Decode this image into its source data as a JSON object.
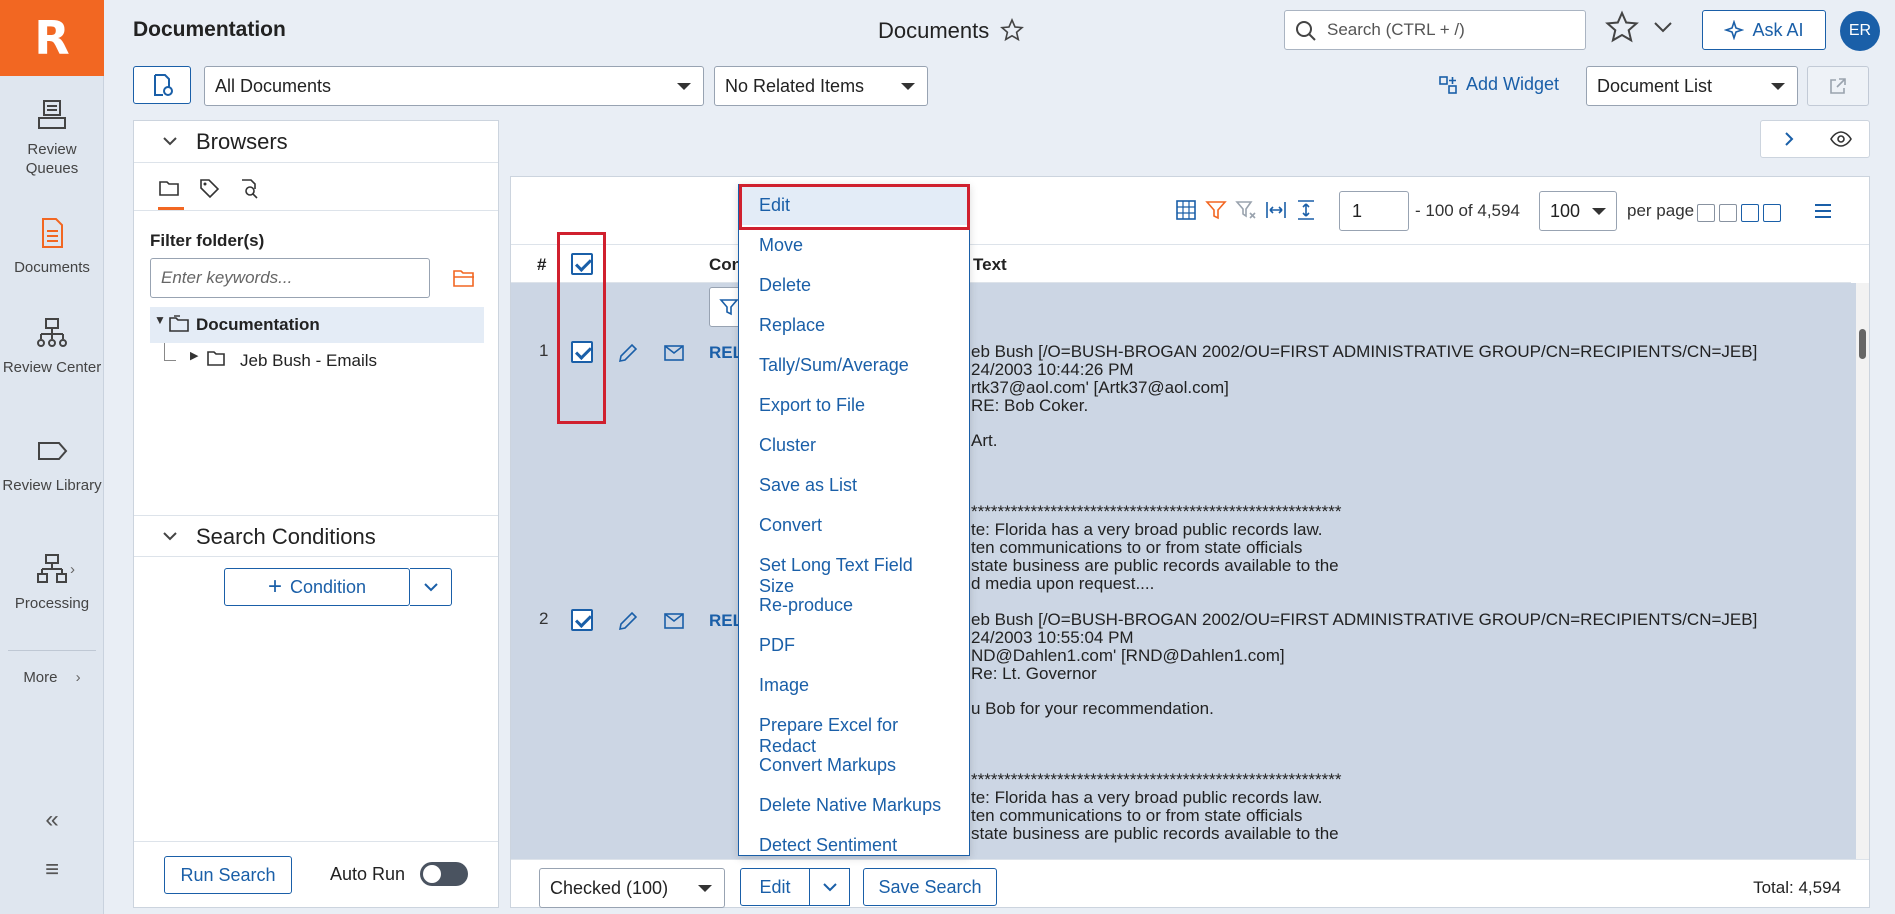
{
  "app": {
    "logo_letter": "R",
    "section_title": "Documentation",
    "page_title": "Documents",
    "search_placeholder": "Search (CTRL + /)",
    "ask_ai_label": "Ask AI",
    "avatar_initials": "ER"
  },
  "nav": {
    "items": [
      {
        "label": "Review Queues",
        "icon": "review-queues-icon"
      },
      {
        "label": "Documents",
        "icon": "documents-icon",
        "active": true
      },
      {
        "label": "Review Center",
        "icon": "review-center-icon"
      },
      {
        "label": "Review Library",
        "icon": "review-library-icon"
      },
      {
        "label": "Processing",
        "icon": "processing-icon"
      }
    ],
    "more_label": "More"
  },
  "toolbar": {
    "view_select": "All Documents",
    "related_select": "No Related Items",
    "add_widget_label": "Add Widget",
    "layout_select": "Document List"
  },
  "browser": {
    "title": "Browsers",
    "filter_label": "Filter folder(s)",
    "filter_placeholder": "Enter keywords...",
    "tree": [
      {
        "label": "Documentation"
      },
      {
        "label": "Jeb Bush - Emails"
      }
    ]
  },
  "search_conditions": {
    "title": "Search Conditions",
    "condition_label": "Condition",
    "run_search_label": "Run Search",
    "auto_run_label": "Auto Run"
  },
  "grid": {
    "page_value": "1",
    "page_range": "- 100 of 4,594",
    "per_page_value": "100",
    "per_page_label": "per page",
    "col_num": "#",
    "col_control": "Cont",
    "col_text": "Text",
    "rows": [
      {
        "num": "1",
        "link": "REL",
        "lines": [
          "eb Bush [/O=BUSH-BROGAN 2002/OU=FIRST ADMINISTRATIVE GROUP/CN=RECIPIENTS/CN=JEB]",
          "24/2003 10:44:26 PM",
          "rtk37@aol.com' [Artk37@aol.com]",
          "RE: Bob Coker.",
          "",
          " Art.",
          "",
          "",
          "********************************************************",
          "te: Florida has a very broad public records law.",
          "ten communications to or from state officials",
          "state business are public records available to the",
          "d media upon request...."
        ]
      },
      {
        "num": "2",
        "link": "REL",
        "lines": [
          "eb Bush [/O=BUSH-BROGAN 2002/OU=FIRST ADMINISTRATIVE GROUP/CN=RECIPIENTS/CN=JEB]",
          "24/2003 10:55:04 PM",
          "ND@Dahlen1.com' [RND@Dahlen1.com]",
          "Re: Lt. Governor",
          "",
          "u Bob for your recommendation.",
          "",
          "",
          "********************************************************",
          "te: Florida has a very broad public records law.",
          "ten communications to or from state officials",
          "state business are public records available to the"
        ]
      }
    ],
    "footer": {
      "checked_select": "Checked (100)",
      "edit_label": "Edit",
      "save_search_label": "Save Search",
      "total": "Total: 4,594"
    }
  },
  "edit_menu": {
    "items": [
      "Edit",
      "Move",
      "Delete",
      "Replace",
      "Tally/Sum/Average",
      "Export to File",
      "Cluster",
      "Save as List",
      "Convert",
      "Set Long Text Field Size",
      "Re-produce",
      "PDF",
      "Image",
      "Prepare Excel for Redact",
      "Convert Markups",
      "Delete Native Markups",
      "Detect Sentiment"
    ]
  },
  "colors": {
    "brand_orange": "#f26722",
    "accent_blue": "#1a5fa8",
    "highlight_red": "#d0202e",
    "row_selected": "#ccd6e4"
  }
}
